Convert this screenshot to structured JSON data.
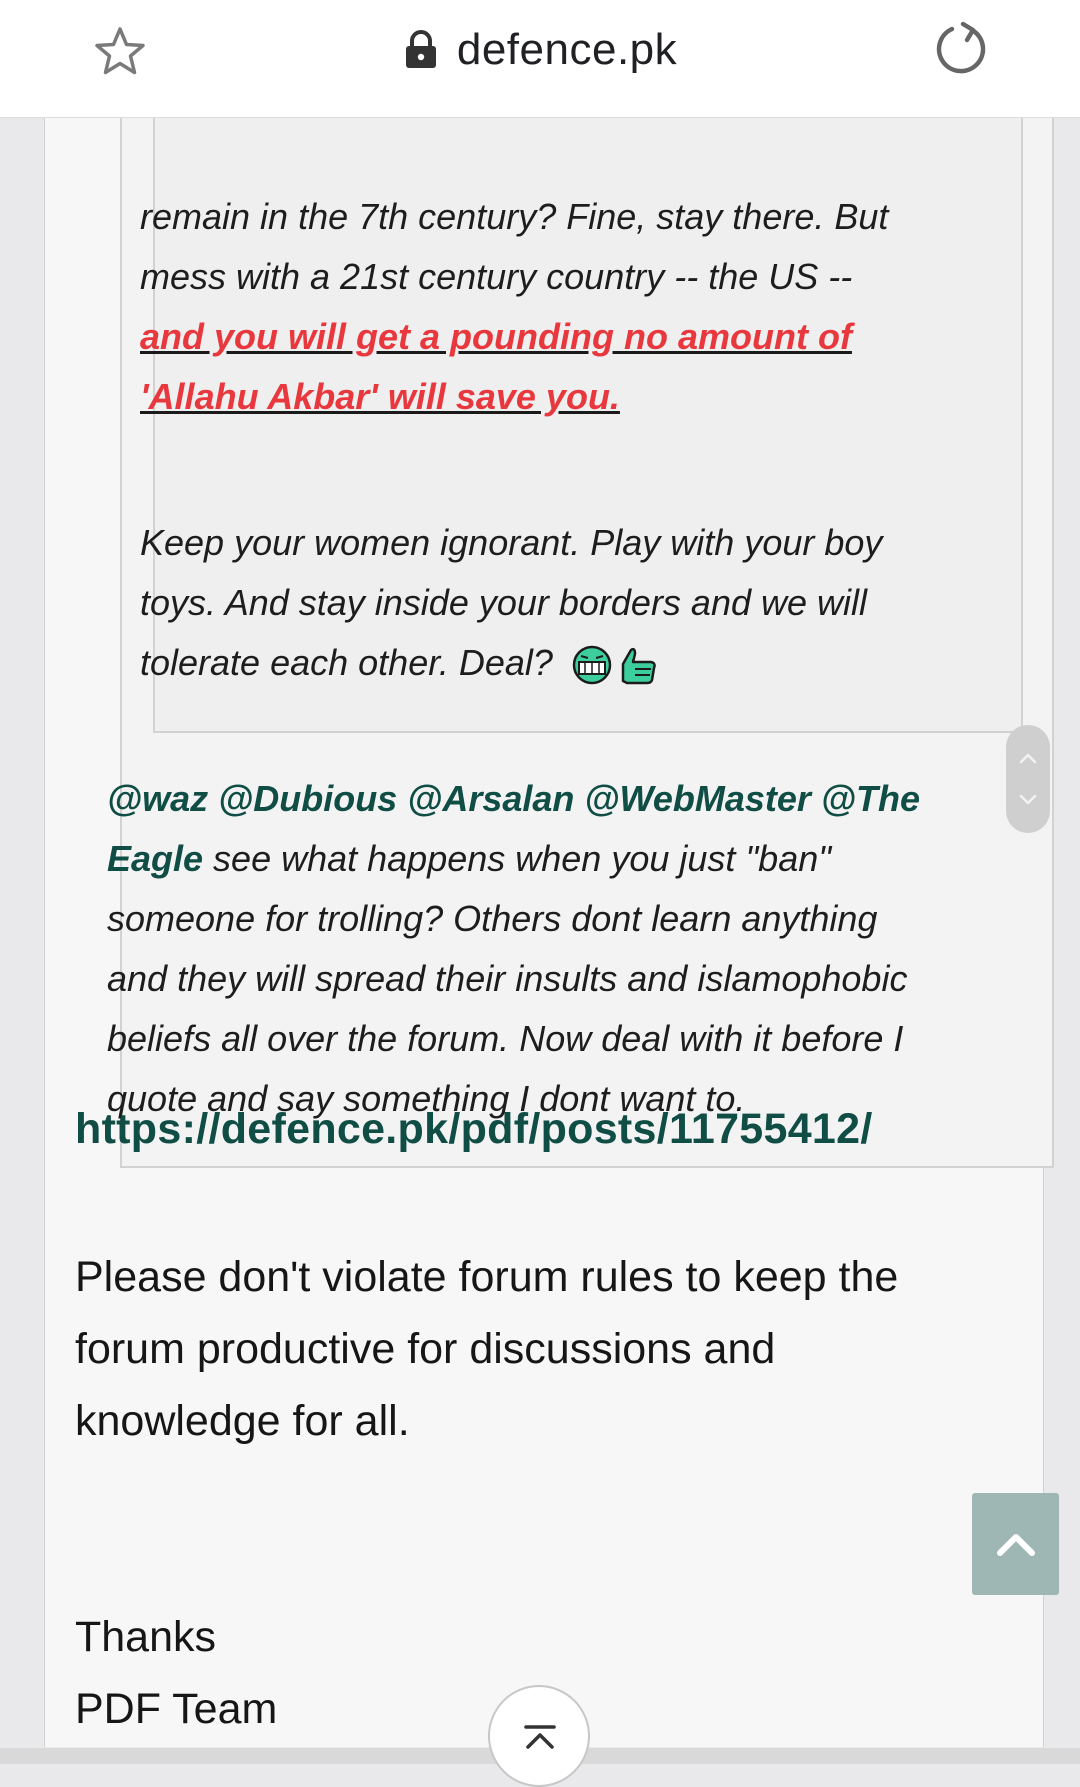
{
  "browser": {
    "url": "defence.pk"
  },
  "inner_quote": {
    "line1": "remain in the 7th century? Fine, stay there. But",
    "line2": "mess with a 21st century country -- the US --",
    "red_line1": "and you will get a pounding no amount of",
    "red_line2": "'Allahu Akbar' will save you.",
    "para2_line1": "Keep your women ignorant. Play with your boy",
    "para2_line2": "toys. And stay inside your borders and we will",
    "para2_line3": "tolerate each other. Deal?"
  },
  "outer_quote": {
    "mentions_line1": "@waz @Dubious @Arsalan @WebMaster @The",
    "mention_eagle": "Eagle",
    "line2_rest": " see what happens when you just \"ban\"",
    "line3": "someone for trolling? Others dont learn anything",
    "line4": "and they will spread their insults and islamophobic",
    "line5": "beliefs all over the forum. Now deal with it before I",
    "line6": "quote and say something I dont want to."
  },
  "post_link": "https://defence.pk/pdf/posts/11755412/",
  "notice": {
    "line1": "Please don't violate forum rules to keep the",
    "line2": "forum productive for discussions and",
    "line3": "knowledge for all."
  },
  "signature": {
    "line1": "Thanks",
    "line2": "PDF Team"
  },
  "icons": {
    "bookmark": "star-icon",
    "secure": "lock-icon",
    "reload": "reload-icon",
    "smiley": "grin-icon",
    "thumbs": "thumbs-up-icon",
    "back_to_top": "chevron-up-icon",
    "scroll_top": "scroll-to-top-icon"
  },
  "colors": {
    "mention": "#0f4d45",
    "highlight_red": "#e8383d",
    "top_button": "#9fb7b4"
  }
}
